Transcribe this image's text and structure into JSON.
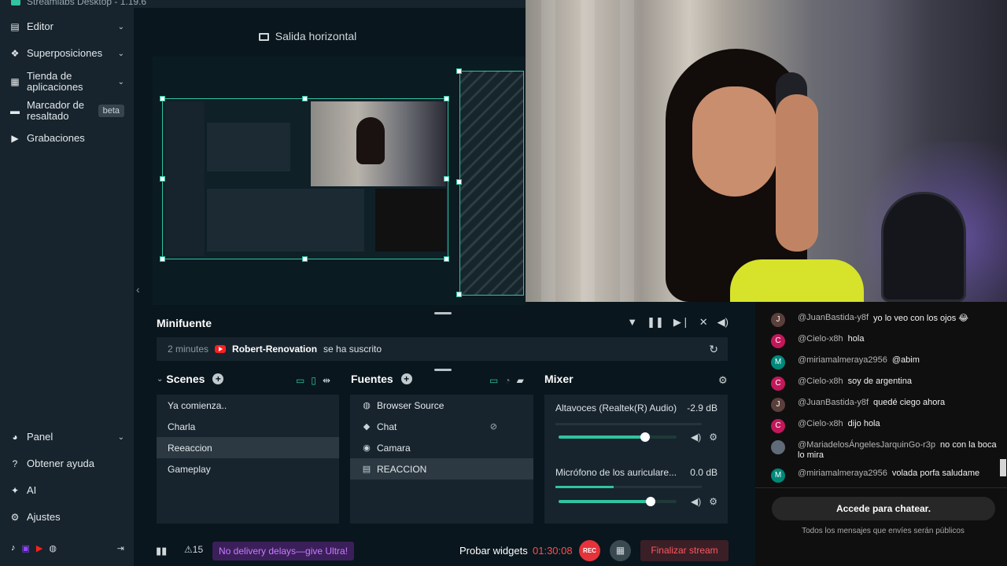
{
  "window": {
    "title": "Streamlabs Desktop - 1.19.6"
  },
  "sidebar": {
    "items": [
      {
        "label": "Editor",
        "icon": "editor-icon"
      },
      {
        "label": "Superposiciones",
        "icon": "overlays-icon"
      },
      {
        "label": "Tienda de aplicaciones",
        "icon": "store-icon"
      },
      {
        "label": "Marcador de resaltado",
        "icon": "highlighter-icon",
        "badge": "beta"
      },
      {
        "label": "Grabaciones",
        "icon": "recordings-icon"
      }
    ],
    "bottom_items": [
      {
        "label": "Panel",
        "icon": "dashboard-icon"
      },
      {
        "label": "Obtener ayuda",
        "icon": "help-icon"
      },
      {
        "label": "AI",
        "icon": "ai-icon"
      },
      {
        "label": "Ajustes",
        "icon": "settings-icon"
      }
    ]
  },
  "editor": {
    "output_title": "Salida horizontal"
  },
  "minifeed": {
    "title": "Minifuente",
    "event": {
      "time": "2 minutes",
      "name": "Robert-Renovation",
      "message": "se ha suscrito"
    }
  },
  "scenes": {
    "title": "Scenes",
    "items": [
      "Ya comienza..",
      "Charla",
      "Reeaccion",
      "Gameplay"
    ],
    "selected_index": 2
  },
  "sources": {
    "title": "Fuentes",
    "items": [
      {
        "label": "Browser Source",
        "icon": "globe-icon"
      },
      {
        "label": "Chat",
        "icon": "chat-icon"
      },
      {
        "label": "Camara",
        "icon": "camera-icon"
      },
      {
        "label": "REACCION",
        "icon": "folder-icon"
      }
    ],
    "selected_index": 3
  },
  "mixer": {
    "title": "Mixer",
    "items": [
      {
        "name": "Altavoces (Realtek(R) Audio)",
        "db": "-2.9 dB",
        "level": 0.0,
        "volume": 0.73
      },
      {
        "name": "Micrófono de los auriculare...",
        "db": "0.0 dB",
        "level": 0.4,
        "volume": 0.78
      }
    ]
  },
  "footer": {
    "alert_count": "15",
    "promo": "No delivery delays—give Ultra!",
    "test_widgets": "Probar widgets",
    "timer": "01:30:08",
    "rec": "REC",
    "end_stream": "Finalizar stream"
  },
  "chat": {
    "messages": [
      {
        "initial": "J",
        "color": "#5b3f3a",
        "author": "@JuanBastida-y8f",
        "text": "yo lo veo con los ojos 😂"
      },
      {
        "initial": "C",
        "color": "#c2185b",
        "author": "@Cielo-x8h",
        "text": "hola"
      },
      {
        "initial": "M",
        "color": "#00897b",
        "author": "@miriamalmeraya2956",
        "text": "@abim"
      },
      {
        "initial": "C",
        "color": "#c2185b",
        "author": "@Cielo-x8h",
        "text": "soy de argentina"
      },
      {
        "initial": "J",
        "color": "#5b3f3a",
        "author": "@JuanBastida-y8f",
        "text": "quedé ciego ahora"
      },
      {
        "initial": "C",
        "color": "#c2185b",
        "author": "@Cielo-x8h",
        "text": "dijo hola"
      },
      {
        "initial": "",
        "color": "#5f6b78",
        "author": "@MariadelosÁngelesJarquinGo-r3p",
        "text": "no con la boca lo mira"
      },
      {
        "initial": "M",
        "color": "#00897b",
        "author": "@miriamalmeraya2956",
        "text": "volada porfa saludame"
      }
    ],
    "button": "Accede para chatear.",
    "note": "Todos los mensajes que envíes serán públicos"
  },
  "colors": {
    "accent": "#31c3a2",
    "background": "#09161d",
    "panel": "#17242d",
    "rec": "#e4333a"
  }
}
